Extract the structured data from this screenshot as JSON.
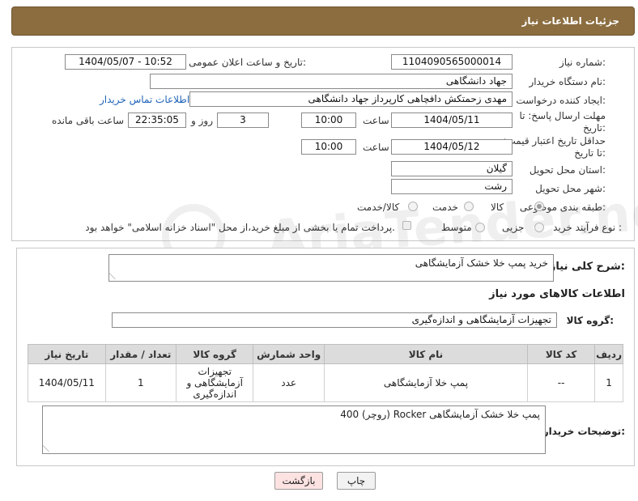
{
  "header": {
    "title": "جزئیات اطلاعات نیاز"
  },
  "form": {
    "need_number_label": "شماره نیاز:",
    "need_number": "1104090565000014",
    "announce_label": "تاریخ و ساعت اعلان عمومی:",
    "announce_value": "1404/05/07 - 10:52",
    "buyer_org_label": "نام دستگاه خریدار:",
    "buyer_org": "جهاد دانشگاهی",
    "creator_label": "ایجاد کننده درخواست:",
    "creator": "مهدی زحمتکش دافچاهی کارپرداز جهاد دانشگاهی",
    "contact_link": "اطلاعات تماس خریدار",
    "reply_deadline_label": "مهلت ارسال پاسخ: تا تاریخ:",
    "reply_date": "1404/05/11",
    "time_label": "ساعت",
    "reply_time": "10:00",
    "days_value": "3",
    "days_label": "روز و",
    "remaining_time": "22:35:05",
    "remaining_label": "ساعت باقی مانده",
    "price_deadline_label": "حداقل تاریخ اعتبار قیمت: تا تاریخ:",
    "price_date": "1404/05/12",
    "price_time_label": "ساعت",
    "price_time": "10:00",
    "province_label": "استان محل تحویل:",
    "province": "گیلان",
    "city_label": "شهر محل تحویل:",
    "city": "رشت",
    "category_label": "طبقه بندی موضوعی:",
    "category_options": [
      "کالا",
      "خدمت",
      "کالا/خدمت"
    ],
    "process_label": "نوع فرآیند خرید :",
    "process_options": [
      "جزیی",
      "متوسط"
    ],
    "payment_note": "پرداخت تمام یا بخشی از مبلغ خرید،از محل \"اسناد خزانه اسلامی\" خواهد بود."
  },
  "summary": {
    "description_label": "شرح کلی نیاز:",
    "description": "خرید پمپ خلا خشک آزمایشگاهی",
    "goods_info_title": "اطلاعات کالاهای مورد نیاز",
    "goods_group_label": "گروه کالا:",
    "goods_group": "تجهیزات آزمایشگاهی و اندازه‌گیری"
  },
  "table": {
    "headers": [
      "ردیف",
      "کد کالا",
      "نام کالا",
      "واحد شمارش",
      "گروه کالا",
      "تعداد / مقدار",
      "تاریخ نیاز"
    ],
    "rows": [
      [
        "1",
        "--",
        "پمپ خلا آزمایشگاهی",
        "عدد",
        "تجهیزات آزمایشگاهی و اندازه‌گیری",
        "1",
        "1404/05/11"
      ]
    ]
  },
  "buyer_notes": {
    "label": "توضیحات خریدار:",
    "text": "پمپ خلا خشک آزمایشگاهی Rocker (روچر) 400"
  },
  "buttons": {
    "print": "چاپ",
    "back": "بازگشت"
  },
  "watermark": "AriaTender.neT",
  "colors": {
    "header_bg": "#8c6d3f",
    "link": "#1f63b8",
    "back_button_bg": "#fde2e2"
  }
}
